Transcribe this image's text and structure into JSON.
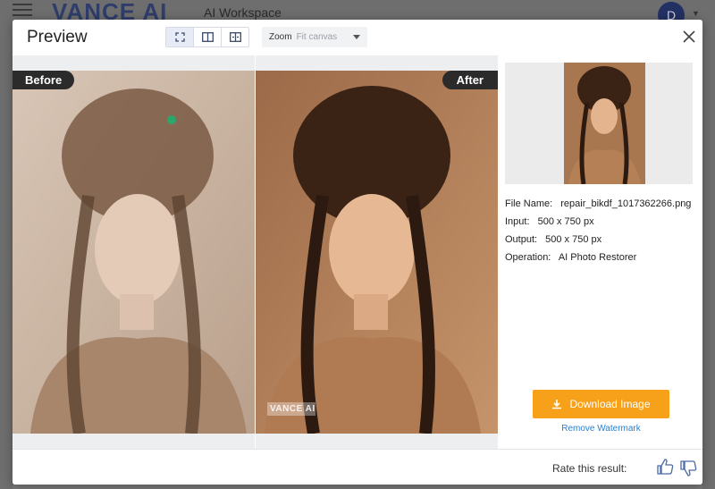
{
  "app": {
    "brand": "VANCE AI",
    "workspace": "AI Workspace",
    "avatar_letter": "D"
  },
  "modal": {
    "title": "Preview",
    "view_modes": [
      "fit-screen-icon",
      "split-view-icon",
      "side-by-side-icon"
    ],
    "zoom_label": "Zoom",
    "zoom_value": "Fit canvas"
  },
  "compare": {
    "before_label": "Before",
    "after_label": "After",
    "watermark": "VANCE AI"
  },
  "info": {
    "file_name_label": "File Name:",
    "file_name": "repair_bikdf_1017362266.png",
    "input_label": "Input:",
    "input_value": "500 x 750 px",
    "output_label": "Output:",
    "output_value": "500 x 750 px",
    "operation_label": "Operation:",
    "operation_value": "AI Photo Restorer"
  },
  "actions": {
    "download_label": "Download Image",
    "remove_watermark_label": "Remove Watermark"
  },
  "footer": {
    "rate_label": "Rate this result:"
  },
  "colors": {
    "accent_orange": "#f7a11a",
    "link_blue": "#2a7fd0",
    "label_dark": "#2b2b2b"
  }
}
